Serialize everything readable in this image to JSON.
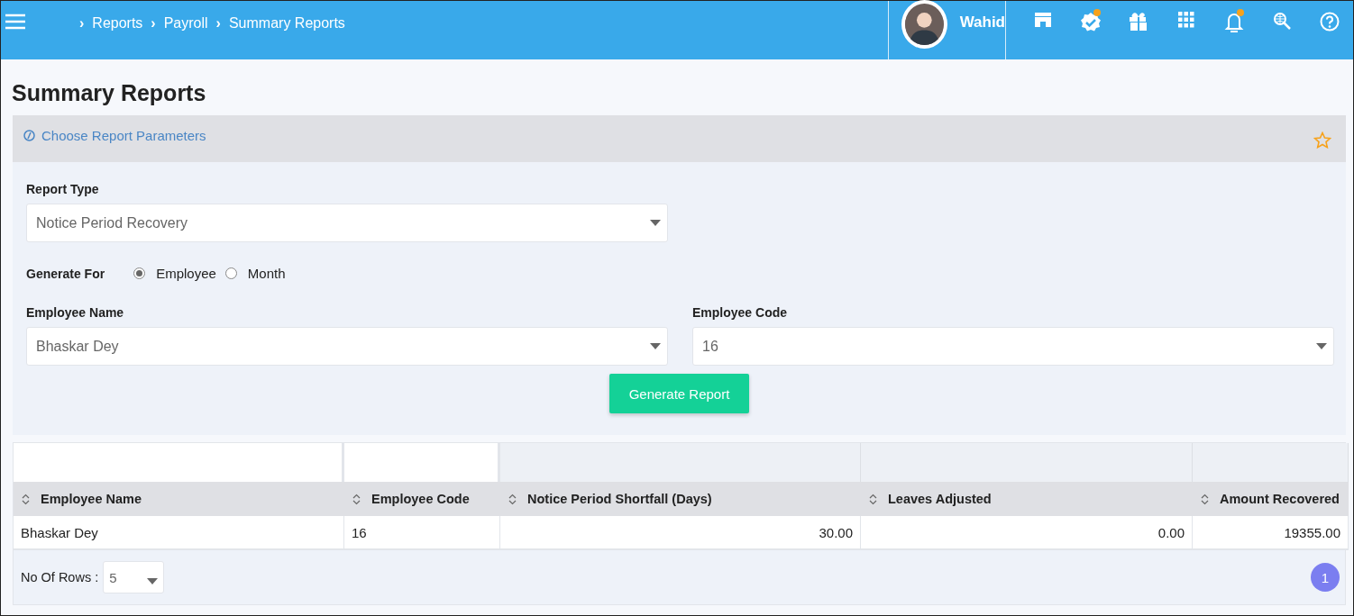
{
  "breadcrumb": [
    {
      "separator": "›",
      "label": "Reports"
    },
    {
      "separator": "›",
      "label": "Payroll"
    },
    {
      "separator": "›",
      "label": "Summary Reports"
    }
  ],
  "user": {
    "name": "Wahid"
  },
  "header_icons": [
    {
      "kind": "store",
      "badge": false
    },
    {
      "kind": "verified",
      "badge": true
    },
    {
      "kind": "gift",
      "badge": false
    },
    {
      "kind": "apps",
      "badge": false
    },
    {
      "kind": "bell",
      "badge": true
    },
    {
      "kind": "globe-search",
      "badge": false
    },
    {
      "kind": "help",
      "badge": false
    }
  ],
  "page_title": "Summary Reports",
  "parameters": {
    "heading": "Choose Report Parameters",
    "favorite": false,
    "report_type": {
      "label": "Report Type",
      "value": "Notice Period Recovery"
    },
    "generate_for": {
      "label": "Generate For",
      "options": [
        {
          "label": "Employee",
          "selected": true
        },
        {
          "label": "Month",
          "selected": false
        }
      ]
    },
    "employee_name": {
      "label": "Employee Name",
      "value": "Bhaskar Dey"
    },
    "employee_code": {
      "label": "Employee Code",
      "value": "16"
    },
    "generate_button": "Generate Report"
  },
  "table": {
    "columns": [
      {
        "label": "Employee Name",
        "kind": "text"
      },
      {
        "label": "Employee Code",
        "kind": "text"
      },
      {
        "label": "Notice Period Shortfall (Days)",
        "kind": "number"
      },
      {
        "label": "Leaves Adjusted",
        "kind": "number"
      },
      {
        "label": "Amount Recovered",
        "kind": "number"
      }
    ],
    "rows": [
      [
        "Bhaskar Dey",
        "16",
        "30.00",
        "0.00",
        "19355.00"
      ]
    ]
  },
  "pagination": {
    "rows_label": "No Of Rows :",
    "rows_value": "5",
    "pages": [
      {
        "label": "1",
        "selected": true
      }
    ]
  }
}
